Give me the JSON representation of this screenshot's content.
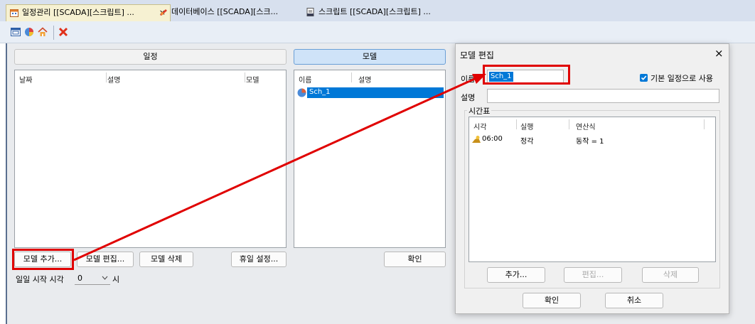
{
  "tabs": [
    {
      "label": "일정관리 [[SCADA][스크립트] ...",
      "close": "×",
      "icon": "schedule-icon"
    },
    {
      "label": "데이터베이스 [[SCADA][스크...",
      "icon": "database-icon"
    },
    {
      "label": "스크립트 [[SCADA][스크립트] ...",
      "icon": "script-icon"
    }
  ],
  "toolbar": {
    "icons": [
      "window-icon",
      "color-wheel-icon",
      "home-icon",
      "delete-icon"
    ]
  },
  "left_panel": {
    "header": "일정",
    "columns": [
      "날짜",
      "설명",
      "모델"
    ],
    "buttons": {
      "add_model": "모델 추가...",
      "edit_model": "모델 편집...",
      "delete_model": "모델 삭제",
      "holiday": "휴일 설정..."
    },
    "day_start": {
      "label": "일일 시작 시각",
      "value": "0",
      "unit": "시"
    }
  },
  "middle_panel": {
    "header": "모델",
    "columns": [
      "이름",
      "설명"
    ],
    "rows": [
      {
        "name": "Sch_1"
      }
    ],
    "confirm": "확인"
  },
  "dialog": {
    "title": "모델 편집",
    "close": "×",
    "name_label": "이름",
    "name_value": "Sch_1",
    "default_checkbox": "기본 일정으로 사용",
    "desc_label": "설명",
    "desc_value": "",
    "group_label": "시간표",
    "columns": [
      "시각",
      "실행",
      "연산식"
    ],
    "rows": [
      {
        "time": "06:00",
        "run": "정각",
        "expr": "동작 = 1"
      }
    ],
    "buttons": {
      "add": "추가...",
      "edit": "편집...",
      "delete": "삭제"
    },
    "ok": "확인",
    "cancel": "취소"
  },
  "colors": {
    "accent": "#0078d7",
    "highlight": "#e00000",
    "selection": "#0078d7"
  }
}
